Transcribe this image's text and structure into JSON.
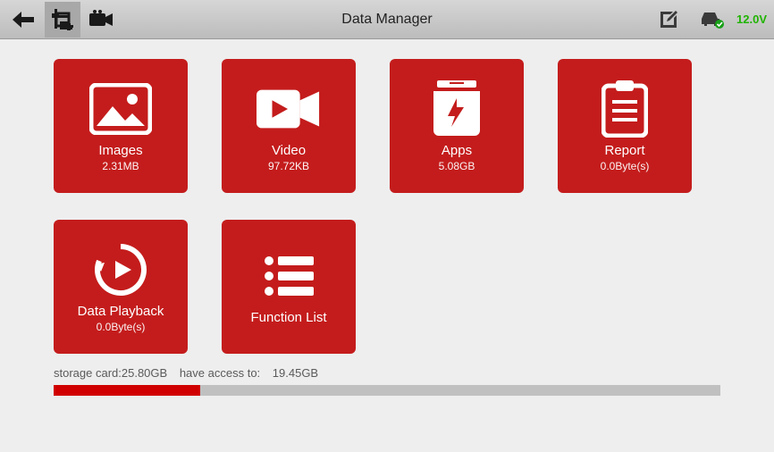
{
  "header": {
    "title": "Data Manager",
    "voltage": "12.0V"
  },
  "tiles": [
    {
      "key": "images",
      "label": "Images",
      "sub": "2.31MB"
    },
    {
      "key": "video",
      "label": "Video",
      "sub": "97.72KB"
    },
    {
      "key": "apps",
      "label": "Apps",
      "sub": "5.08GB"
    },
    {
      "key": "report",
      "label": "Report",
      "sub": "0.0Byte(s)"
    },
    {
      "key": "playback",
      "label": "Data Playback",
      "sub": "0.0Byte(s)"
    },
    {
      "key": "functionlist",
      "label": "Function List",
      "sub": ""
    }
  ],
  "storage": {
    "card_label": "storage card:",
    "card_value": "25.80GB",
    "access_label": "have access to:",
    "access_value": "19.45GB",
    "used_pct": 22
  },
  "colors": {
    "tile_bg": "#c41c1c",
    "voltage": "#1fb400",
    "bar_fill": "#d10000"
  }
}
